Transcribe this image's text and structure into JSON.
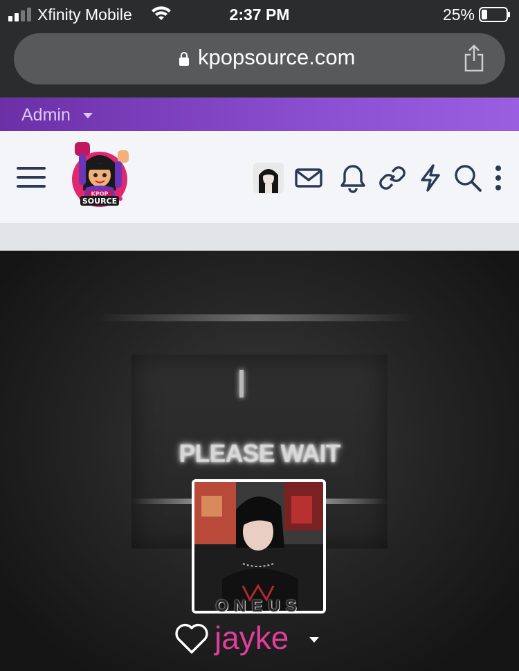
{
  "status_bar": {
    "carrier": "Xfinity Mobile",
    "time": "2:37 PM",
    "battery_percent": "25%"
  },
  "address_bar": {
    "url": "kpopsource.com"
  },
  "admin_bar": {
    "label": "Admin"
  },
  "header": {
    "icons": [
      "menu-icon",
      "avatar",
      "mail-icon",
      "bell-icon",
      "link-icon",
      "lightning-icon",
      "search-icon",
      "more-icon"
    ]
  },
  "cover": {
    "overlay_text": "PLEASE WAIT",
    "card_caption": "ONEUS"
  },
  "profile": {
    "username": "jayke"
  },
  "colors": {
    "admin_purple": "#7a3fc0",
    "username_pink": "#e23d9a",
    "header_icon": "#2a3a55"
  }
}
